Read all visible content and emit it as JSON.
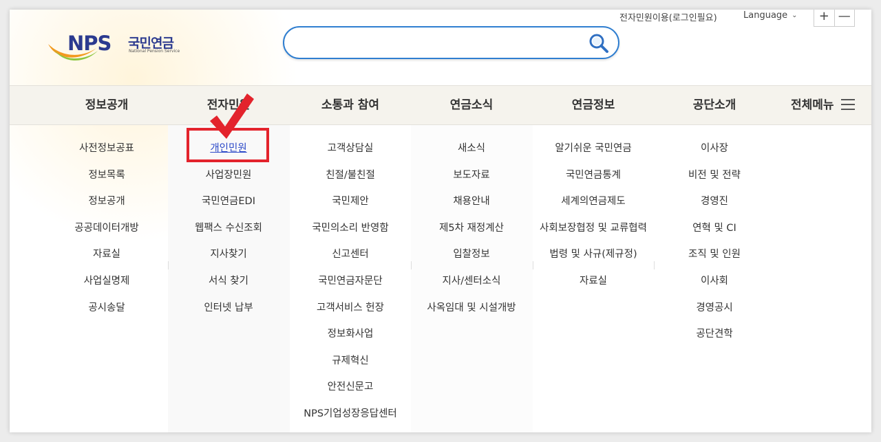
{
  "brand": {
    "logo_text": "NPS",
    "logo_ko": "국민연금",
    "logo_en": "National Pension Service",
    "primary_color": "#2b3a8f",
    "accent_color": "#2f7ed0",
    "highlight_color": "#e3232c"
  },
  "search": {
    "placeholder": "",
    "value": "",
    "icon": "search-icon"
  },
  "util": {
    "login_link": "전자민원이용(로그인필요)",
    "language": "Language",
    "zoom_in": "+",
    "zoom_out": "—"
  },
  "gnb": {
    "items": [
      {
        "label": "정보공개"
      },
      {
        "label": "전자민원"
      },
      {
        "label": "소통과 참여"
      },
      {
        "label": "연금소식"
      },
      {
        "label": "연금정보"
      },
      {
        "label": "공단소개"
      }
    ],
    "all_menu": "전체메뉴"
  },
  "submenu": [
    {
      "items": [
        "사전정보공표",
        "정보목록",
        "정보공개",
        "공공데이터개방",
        "자료실",
        "사업실명제",
        "공시송달"
      ]
    },
    {
      "items": [
        "개인민원",
        "사업장민원",
        "국민연금EDI",
        "웹팩스 수신조회",
        "지사찾기",
        "서식 찾기",
        "인터넷 납부"
      ]
    },
    {
      "items": [
        "고객상담실",
        "친절/불친절",
        "국민제안",
        "국민의소리 반영함",
        "신고센터",
        "국민연금자문단",
        "고객서비스 헌장",
        "정보화사업",
        "규제혁신",
        "안전신문고",
        "NPS기업성장응답센터"
      ]
    },
    {
      "items": [
        "새소식",
        "보도자료",
        "채용안내",
        "제5차 재정계산",
        "입찰정보",
        "지사/센터소식",
        "사옥임대 및 시설개방"
      ]
    },
    {
      "items": [
        "알기쉬운 국민연금",
        "국민연금통계",
        "세계의연금제도",
        "사회보장협정 및 교류협력",
        "법령 및 사규(제규정)",
        "자료실"
      ]
    },
    {
      "items": [
        "이사장",
        "비전 및 전략",
        "경영진",
        "연혁 및 CI",
        "조직 및 인원",
        "이사회",
        "경영공시",
        "공단견학"
      ]
    }
  ],
  "active_submenu": "개인민원"
}
